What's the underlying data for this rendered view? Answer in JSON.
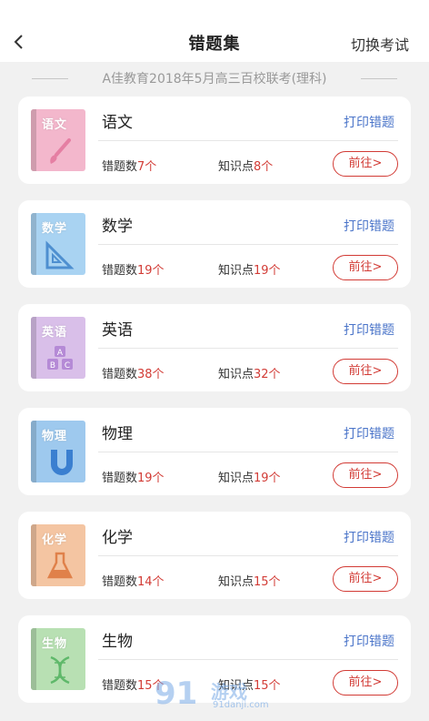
{
  "header": {
    "title": "错题集",
    "action_label": "切换考试"
  },
  "exam_title": "A佳教育2018年5月高三百校联考(理科)",
  "labels": {
    "print": "打印错题",
    "go": "前往>",
    "wrong_count_prefix": "错题数",
    "knowledge_prefix": "知识点"
  },
  "subjects": [
    {
      "name": "语文",
      "book_label": "语文",
      "wrong": "7个",
      "knowledge": "8个",
      "book_color": "#f3b7cc",
      "art_icon": "brush-icon"
    },
    {
      "name": "数学",
      "book_label": "数学",
      "wrong": "19个",
      "knowledge": "19个",
      "book_color": "#a9d3f2",
      "art_icon": "ruler-icon"
    },
    {
      "name": "英语",
      "book_label": "英语",
      "wrong": "38个",
      "knowledge": "32个",
      "book_color": "#d9bfe9",
      "art_icon": "abc-blocks-icon"
    },
    {
      "name": "物理",
      "book_label": "物理",
      "wrong": "19个",
      "knowledge": "19个",
      "book_color": "#9ec9ee",
      "art_icon": "magnet-icon"
    },
    {
      "name": "化学",
      "book_label": "化学",
      "wrong": "14个",
      "knowledge": "15个",
      "book_color": "#f4c5a2",
      "art_icon": "flask-icon"
    },
    {
      "name": "生物",
      "book_label": "生物",
      "wrong": "15个",
      "knowledge": "15个",
      "book_color": "#b8e0b3",
      "art_icon": "dna-icon"
    }
  ],
  "watermark": {
    "number": "91",
    "name": "游戏",
    "url": "91danji.com"
  }
}
